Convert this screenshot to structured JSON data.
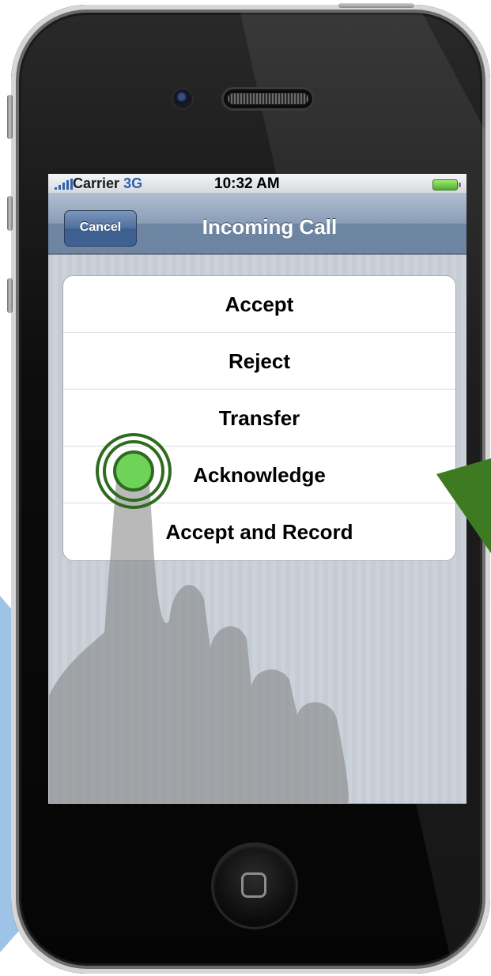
{
  "status_bar": {
    "carrier": "Carrier",
    "network": "3G",
    "time": "10:32 AM",
    "battery_icon": "battery-full-icon",
    "signal_icon": "signal-bars-icon"
  },
  "nav_bar": {
    "cancel_label": "Cancel",
    "title": "Incoming Call"
  },
  "options": [
    {
      "label": "Accept"
    },
    {
      "label": "Reject"
    },
    {
      "label": "Transfer"
    },
    {
      "label": "Acknowledge"
    },
    {
      "label": "Accept and Record"
    }
  ],
  "colors": {
    "touch_indicator": "#6fd35a",
    "touch_ring": "#2e6b1f",
    "annotation_blue": "#9dc3e6",
    "arrow_green": "#3e7a22",
    "nav_bar": "#6d84a2"
  }
}
